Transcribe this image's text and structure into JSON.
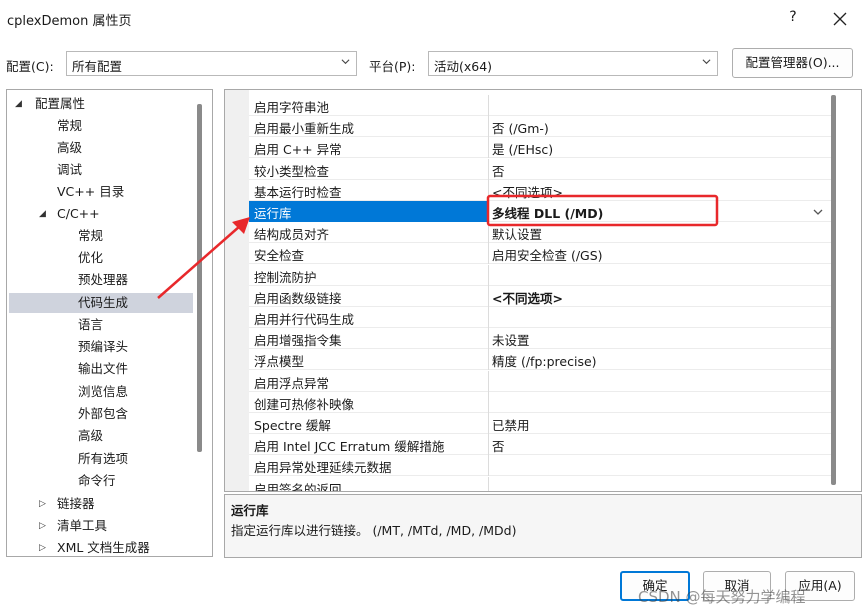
{
  "window": {
    "title": "cplexDemon 属性页",
    "help_label": "?",
    "close_label": "✕"
  },
  "config_bar": {
    "config_label": "配置(C):",
    "config_value": "所有配置",
    "platform_label": "平台(P):",
    "platform_value": "活动(x64)",
    "manager_button": "配置管理器(O)..."
  },
  "tree": {
    "root": "配置属性",
    "items": [
      "常规",
      "高级",
      "调试",
      "VC++ 目录"
    ],
    "cpp_group": "C/C++",
    "cpp_items": [
      "常规",
      "优化",
      "预处理器",
      "代码生成",
      "语言",
      "预编译头",
      "输出文件",
      "浏览信息",
      "外部包含",
      "高级",
      "所有选项",
      "命令行"
    ],
    "selected": "代码生成",
    "collapsed_groups": [
      "链接器",
      "清单工具",
      "XML 文档生成器"
    ]
  },
  "properties": [
    {
      "name": "启用字符串池",
      "value": ""
    },
    {
      "name": "启用最小重新生成",
      "value": "否 (/Gm-)"
    },
    {
      "name": "启用 C++ 异常",
      "value": "是 (/EHsc)"
    },
    {
      "name": "较小类型检查",
      "value": "否"
    },
    {
      "name": "基本运行时检查",
      "value": "<不同选项>"
    },
    {
      "name": "运行库",
      "value": "多线程 DLL (/MD)"
    },
    {
      "name": "结构成员对齐",
      "value": "默认设置"
    },
    {
      "name": "安全检查",
      "value": "启用安全检查 (/GS)"
    },
    {
      "name": "控制流防护",
      "value": ""
    },
    {
      "name": "启用函数级链接",
      "value": "<不同选项>"
    },
    {
      "name": "启用并行代码生成",
      "value": ""
    },
    {
      "name": "启用增强指令集",
      "value": "未设置"
    },
    {
      "name": "浮点模型",
      "value": "精度 (/fp:precise)"
    },
    {
      "name": "启用浮点异常",
      "value": ""
    },
    {
      "name": "创建可热修补映像",
      "value": ""
    },
    {
      "name": "Spectre 缓解",
      "value": "已禁用"
    },
    {
      "name": "启用 Intel JCC Erratum 缓解措施",
      "value": "否"
    },
    {
      "name": "启用异常处理延续元数据",
      "value": ""
    },
    {
      "name": "启用签名的返回",
      "value": ""
    }
  ],
  "selected_property": "运行库",
  "description": {
    "title": "运行库",
    "text": "指定运行库以进行链接。     (/MT, /MTd, /MD, /MDd)"
  },
  "buttons": {
    "ok": "确定",
    "cancel": "取消",
    "apply": "应用(A)"
  },
  "watermark": "CSDN @每天努力学编程",
  "colors": {
    "selection": "#0078d7",
    "annotation": "#e8282b",
    "tree_selection": "#cfd3dd"
  }
}
